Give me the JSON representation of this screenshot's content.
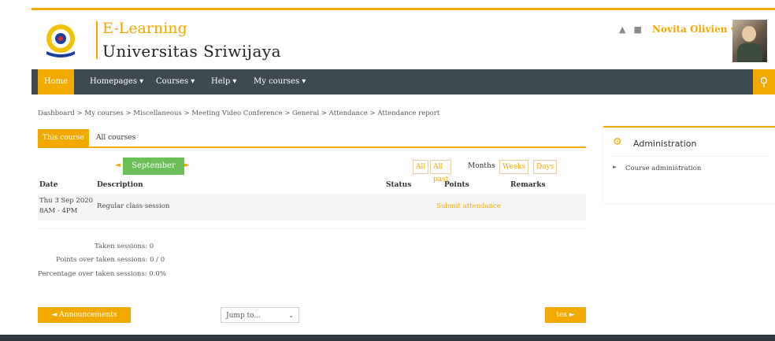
{
  "brand": {
    "line1": "E-Learning",
    "line2": "Universitas  Sriwijaya",
    "accent": "#f2a900"
  },
  "header": {
    "user_name": "Novita Olivien",
    "icons": [
      "bell-icon",
      "message-icon"
    ]
  },
  "nav": {
    "home": "Home",
    "homepages": "Homepages ▾",
    "courses": "Courses ▾",
    "help": "Help ▾",
    "mycourses": "My courses ▾",
    "search_icon": "search-icon"
  },
  "breadcrumb": "Dashboard > My courses > Miscellaneous > Meeting Video Conference > General > Attendance > Attendance report",
  "tabs": {
    "this_course": "This course",
    "all_courses": "All courses"
  },
  "month": "September",
  "view_buttons": {
    "all": "All",
    "all_past": "All past",
    "months": "Months",
    "weeks": "Weeks",
    "days": "Days"
  },
  "table": {
    "headers": {
      "date": "Date",
      "description": "Description",
      "status": "Status",
      "points": "Points",
      "remarks": "Remarks"
    },
    "rows": [
      {
        "date_line1": "Thu 3 Sep 2020",
        "date_line2": "8AM - 4PM",
        "description": "Regular class session",
        "action": "Submit attendance"
      }
    ]
  },
  "summary": {
    "taken": "Taken sessions: 0",
    "points": "Points over taken sessions: 0 / 0",
    "percentage": "Percentage over taken sessions: 0.0%"
  },
  "footer_nav": {
    "prev": "◄ Announcements",
    "jump": "Jump to...",
    "next": "tes ►"
  },
  "admin": {
    "title": "Administration",
    "item": "Course administration"
  },
  "colors": {
    "accent": "#f2a900",
    "navbar": "#3d4a51",
    "month_pill": "#6bbf59"
  }
}
